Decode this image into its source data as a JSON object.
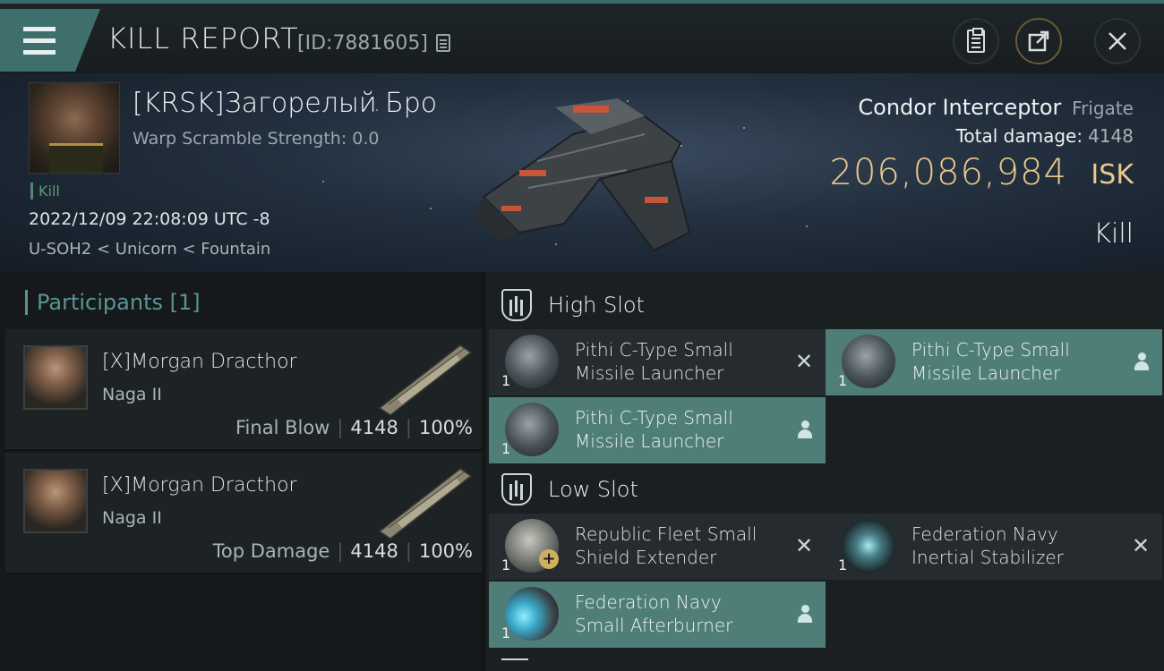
{
  "header": {
    "title": "KILL REPORT",
    "id_label": "[ID:7881605]"
  },
  "victim": {
    "name": "[KRSK]Загорелый Бро",
    "warp_scramble": "Warp Scramble Strength: 0.0",
    "tag": "Kill",
    "datetime": "2022/12/09 22:08:09 UTC -8",
    "location": "U-SOH2 < Unicorn < Fountain",
    "ship_name": "Condor Interceptor",
    "ship_class": "Frigate",
    "total_damage_label": "Total damage:",
    "total_damage_value": "4148",
    "isk_value": "206,086,984",
    "isk_unit": "ISK",
    "result": "Kill"
  },
  "participants": {
    "heading": "Participants [1]",
    "items": [
      {
        "name": "[X]Morgan Dracthor",
        "ship": "Naga II",
        "role": "Final Blow",
        "damage": "4148",
        "percent": "100%"
      },
      {
        "name": "[X]Morgan Dracthor",
        "ship": "Naga II",
        "role": "Top Damage",
        "damage": "4148",
        "percent": "100%"
      }
    ]
  },
  "fitting": {
    "high_slot": {
      "label": "High Slot",
      "modules": [
        {
          "line1": "Pithi C-Type Small",
          "line2": "Missile Launcher",
          "qty": "1",
          "state": "destroyed"
        },
        {
          "line1": "Pithi C-Type Small",
          "line2": "Missile Launcher",
          "qty": "1",
          "state": "dropped"
        },
        {
          "line1": "Pithi C-Type Small",
          "line2": "Missile Launcher",
          "qty": "1",
          "state": "dropped"
        }
      ]
    },
    "low_slot": {
      "label": "Low Slot",
      "modules": [
        {
          "line1": "Republic Fleet Small",
          "line2": "Shield Extender",
          "qty": "1",
          "state": "destroyed"
        },
        {
          "line1": "Federation Navy",
          "line2": "Inertial Stabilizer",
          "qty": "1",
          "state": "destroyed"
        },
        {
          "line1": "Federation Navy",
          "line2": "Small Afterburner",
          "qty": "1",
          "state": "dropped"
        }
      ]
    }
  },
  "colors": {
    "accent_teal": "#4f7e78",
    "isk_gold": "#e8c98c",
    "kill_green": "#5a9a78"
  }
}
